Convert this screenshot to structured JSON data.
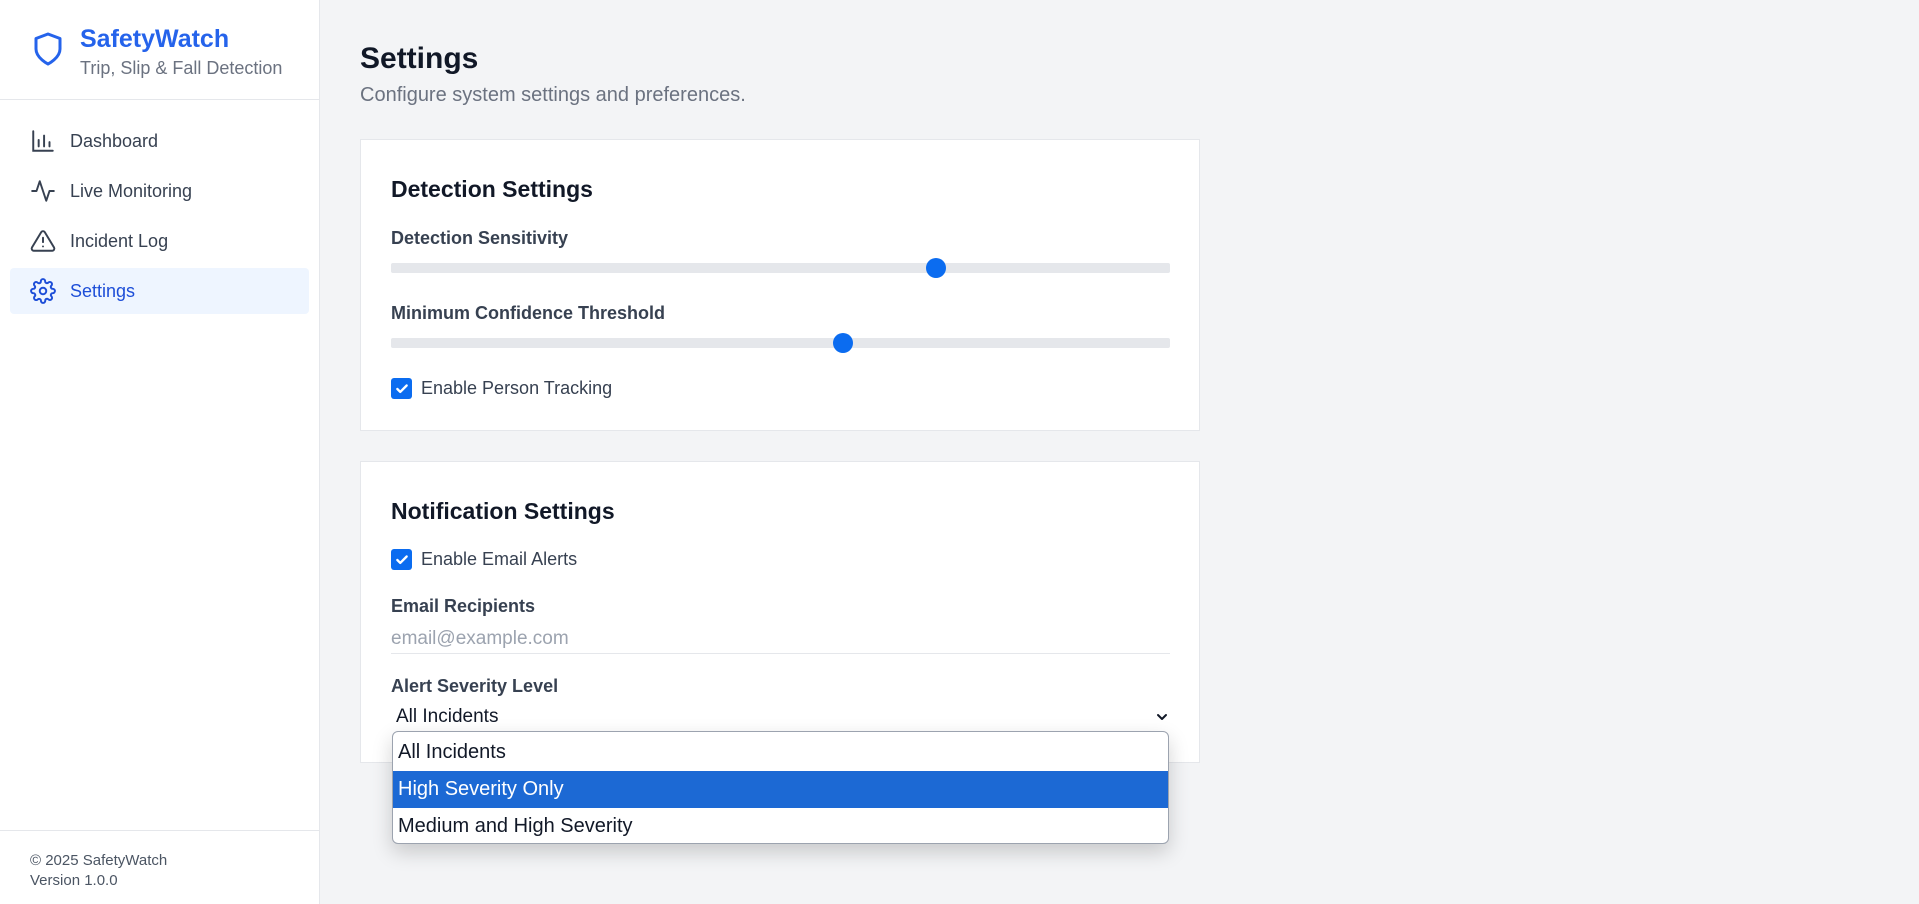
{
  "brand": {
    "name": "SafetyWatch",
    "tagline": "Trip, Slip & Fall Detection",
    "accent_color": "#2563eb",
    "icon": "shield-icon"
  },
  "nav": {
    "items": [
      {
        "label": "Dashboard",
        "icon": "bar-chart-icon",
        "active": false
      },
      {
        "label": "Live Monitoring",
        "icon": "activity-icon",
        "active": false
      },
      {
        "label": "Incident Log",
        "icon": "alert-triangle-icon",
        "active": false
      },
      {
        "label": "Settings",
        "icon": "gear-icon",
        "active": true
      }
    ]
  },
  "footer": {
    "copyright": "© 2025 SafetyWatch",
    "version": "Version 1.0.0"
  },
  "page": {
    "title": "Settings",
    "subtitle": "Configure system settings and preferences."
  },
  "detection": {
    "title": "Detection Settings",
    "sensitivity_label": "Detection Sensitivity",
    "sensitivity_value": 0.7,
    "confidence_label": "Minimum Confidence Threshold",
    "confidence_value": 0.58,
    "tracking_label": "Enable Person Tracking",
    "tracking_checked": true
  },
  "notification": {
    "title": "Notification Settings",
    "email_alerts_label": "Enable Email Alerts",
    "email_alerts_checked": true,
    "recipients_label": "Email Recipients",
    "recipients_value": "",
    "recipients_placeholder": "email@example.com",
    "severity_label": "Alert Severity Level",
    "severity_value": "All Incidents",
    "severity_options": [
      "All Incidents",
      "High Severity Only",
      "Medium and High Severity"
    ],
    "highlighted_option_index": 1
  },
  "colors": {
    "slider_thumb": "#0b6cf0",
    "dropdown_highlight": "#1c69d4",
    "active_nav_bg": "#eef5ff"
  }
}
